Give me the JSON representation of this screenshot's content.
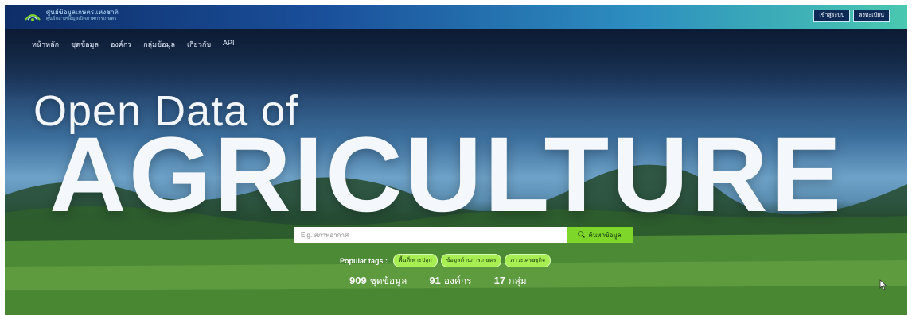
{
  "header": {
    "logo": {
      "title": "ศูนย์ข้อมูลเกษตรแห่งชาติ",
      "subtitle": "ศูนย์กลางข้อมูลเปิดภาคการเกษตร"
    },
    "auth": [
      {
        "label": "เข้าสู่ระบบ"
      },
      {
        "label": "ลงทะเบียน"
      }
    ]
  },
  "nav": [
    {
      "label": "หน้าหลัก"
    },
    {
      "label": "ชุดข้อมูล"
    },
    {
      "label": "องค์กร"
    },
    {
      "label": "กลุ่มข้อมูล"
    },
    {
      "label": "เกี่ยวกับ"
    },
    {
      "label": "API"
    }
  ],
  "hero": {
    "line1": "Open Data of",
    "line2": "AGRICULTURE"
  },
  "search": {
    "placeholder": "E.g. สภาพอากาศ",
    "button_label": "ค้นหาข้อมูล"
  },
  "popular_tags": {
    "label": "Popular tags :",
    "tags": [
      {
        "label": "พื้นที่เพาะปลูก"
      },
      {
        "label": "ข้อมูลด้านการเกษตร"
      },
      {
        "label": "ภาวะเศรษฐกิจ"
      }
    ]
  },
  "stats": [
    {
      "value": "909",
      "label": "ชุดข้อมูล"
    },
    {
      "value": "91",
      "label": "องค์กร"
    },
    {
      "value": "17",
      "label": "กลุ่ม"
    }
  ],
  "colors": {
    "accent": "#7fd62a",
    "tag": "#a6ee52",
    "topbar": "#1a4f9a"
  }
}
